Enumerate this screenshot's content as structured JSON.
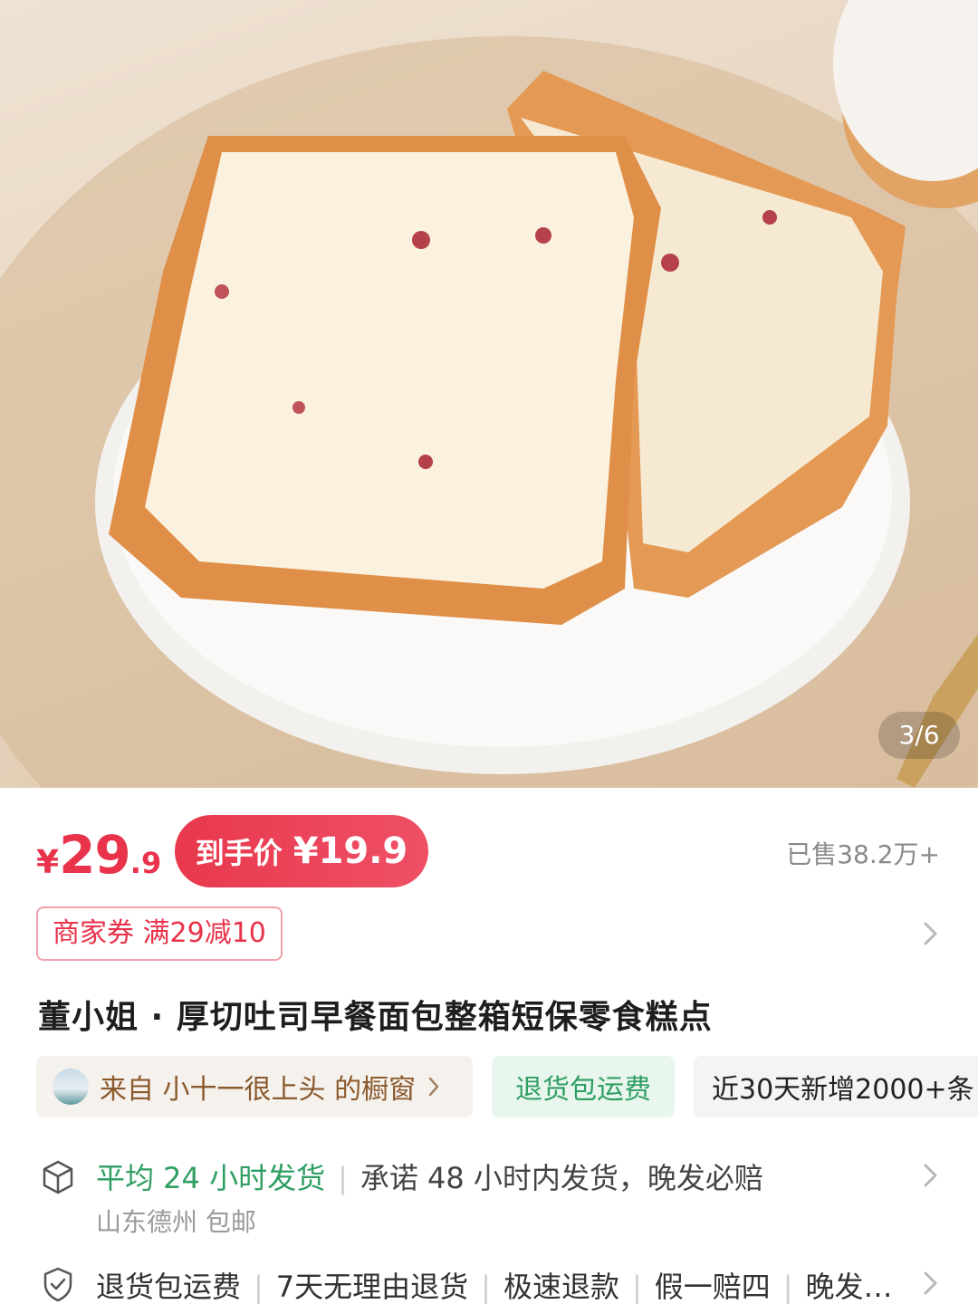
{
  "gallery": {
    "counter": "3/6"
  },
  "price": {
    "symbol": "¥",
    "integer": "29",
    "decimal": ".9",
    "deal_label": "到手价",
    "deal_amount": "¥19.9",
    "sold": "已售38.2万+"
  },
  "coupon": {
    "text": "商家券 满29减10"
  },
  "product": {
    "title": "董小姐 · 厚切吐司早餐面包整箱短保零食糕点"
  },
  "chips": {
    "source": "来自 小十一很上头 的橱窗",
    "refund": "退货包运费",
    "trend": "近30天新增2000+条"
  },
  "shipping": {
    "fast": "平均 24 小时发货",
    "promise": "承诺 48 小时内发货，晚发必赔",
    "origin": "山东德州 包邮"
  },
  "services": {
    "items": [
      "退货包运费",
      "7天无理由退货",
      "极速退款",
      "假一赔四",
      "晚发…"
    ]
  },
  "colors": {
    "accent_red": "#e8334a",
    "accent_green": "#2e9e62"
  },
  "icons": {
    "shipping": "box-icon",
    "services": "shield-check-icon",
    "chevron": "chevron-right-icon"
  }
}
